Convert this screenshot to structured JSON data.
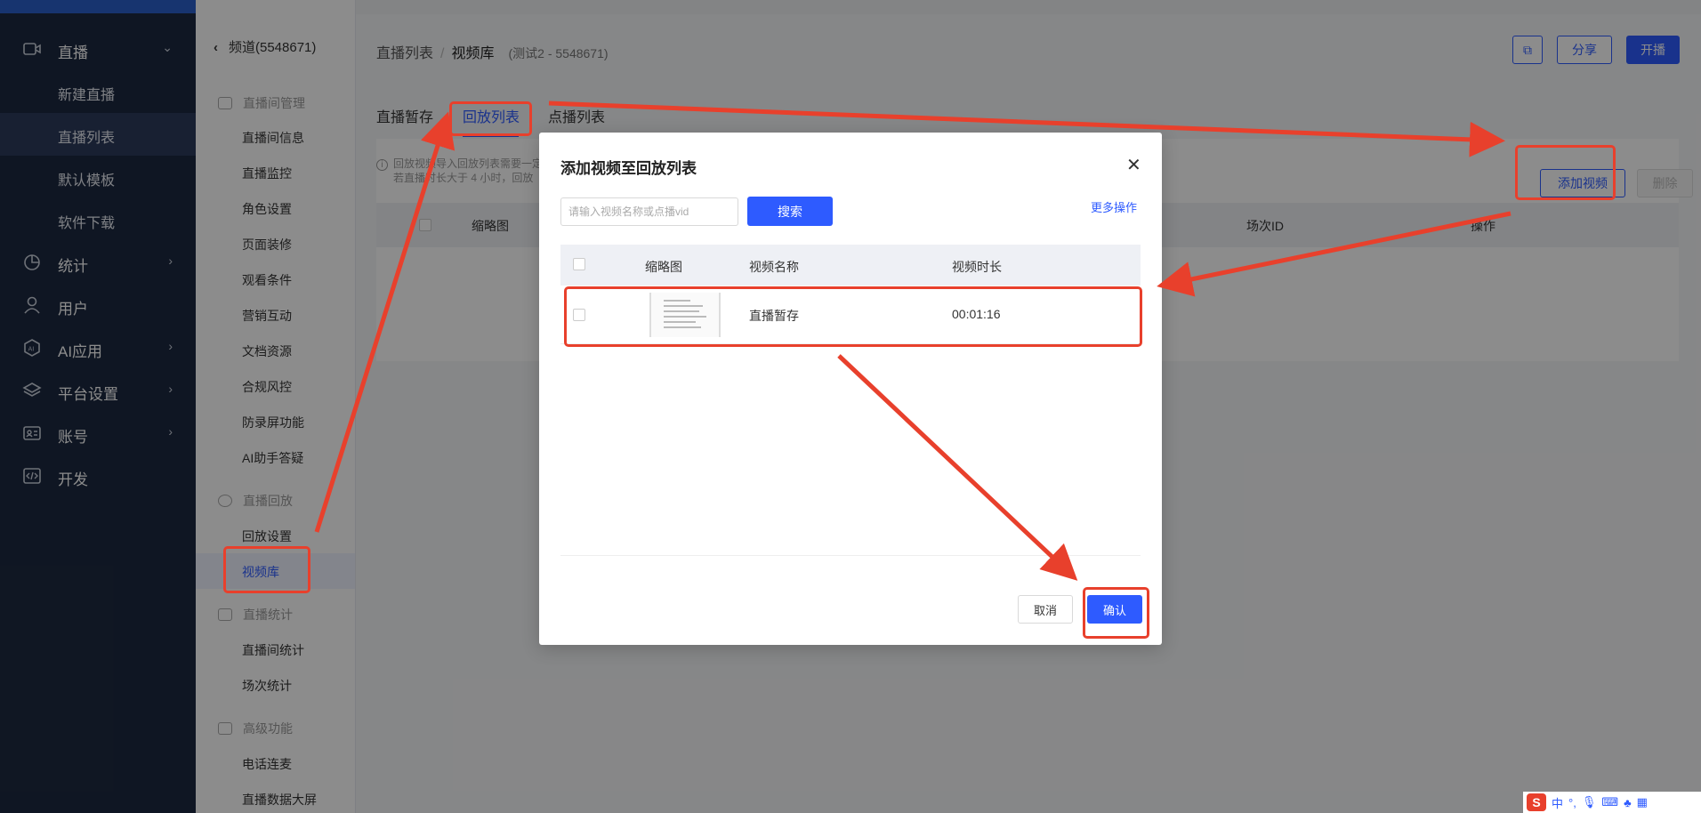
{
  "nav": {
    "items": [
      {
        "label": "直播",
        "icon": "video-icon"
      },
      {
        "label": "统计",
        "icon": "pie-chart-icon"
      },
      {
        "label": "用户",
        "icon": "user-icon"
      },
      {
        "label": "AI应用",
        "icon": "ai-icon"
      },
      {
        "label": "平台设置",
        "icon": "layers-icon"
      },
      {
        "label": "账号",
        "icon": "id-card-icon"
      },
      {
        "label": "开发",
        "icon": "code-icon"
      }
    ],
    "live_sub": [
      "新建直播",
      "直播列表",
      "默认模板",
      "软件下载"
    ]
  },
  "subnav": {
    "title": "频道(5548671)",
    "groups": [
      {
        "label": "直播间管理",
        "items": [
          "直播间信息",
          "直播监控",
          "角色设置",
          "页面装修",
          "观看条件",
          "营销互动",
          "文档资源",
          "合规风控",
          "防录屏功能",
          "AI助手答疑"
        ]
      },
      {
        "label": "直播回放",
        "items": [
          "回放设置",
          "视频库"
        ]
      },
      {
        "label": "直播统计",
        "items": [
          "直播间统计",
          "场次统计"
        ]
      },
      {
        "label": "高级功能",
        "items": [
          "电话连麦",
          "直播数据大屏"
        ]
      }
    ]
  },
  "main": {
    "breadcrumb": [
      "直播列表",
      "视频库"
    ],
    "breadcrumb_sub": "(测试2 - 5548671)",
    "header_buttons": {
      "copy_icon": "copy-icon",
      "share": "分享",
      "start": "开播"
    },
    "tabs": [
      "直播暂存",
      "回放列表",
      "点播列表"
    ],
    "info_lines": [
      "回放视频导入回放列表需要一定",
      "若直播时长大于 4 小时，回放"
    ],
    "table_headers": [
      "缩略图",
      "场次ID",
      "操作"
    ],
    "add_video": "添加视频",
    "delete": "删除"
  },
  "modal": {
    "title": "添加视频至回放列表",
    "search_placeholder": "请输入视频名称或点播vid",
    "search_btn": "搜索",
    "more": "更多操作",
    "headers": [
      "缩略图",
      "视频名称",
      "视频时长"
    ],
    "rows": [
      {
        "name": "直播暂存",
        "duration": "00:01:16"
      }
    ],
    "cancel": "取消",
    "confirm": "确认"
  },
  "ime": {
    "lang": "中"
  },
  "colors": {
    "nav_bg": "#1d2940",
    "accent": "#2e5bff",
    "annotation": "#e8402c"
  }
}
